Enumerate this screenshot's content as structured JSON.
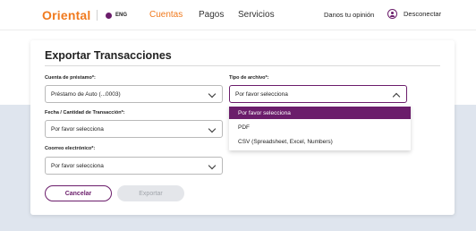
{
  "nav": {
    "logo": "Oriental",
    "lang": "ENG",
    "links": [
      "Cuentas",
      "Pagos",
      "Servicios"
    ],
    "feedback": "Danos tu opinión",
    "logout": "Desconectar"
  },
  "modal": {
    "title": "Exportar Transacciones",
    "loan_account_label": "Cuenta de préstamo*:",
    "loan_account_value": "Préstamo de Auto (...0003)",
    "file_type_label": "Tipo de archivo*:",
    "file_type_value": "Por favor selecciona",
    "date_label": "Fecha / Cantidad de Transacción*:",
    "date_value": "Por favor selecciona",
    "email_label": "Coorreo electrónico*:",
    "email_value": "Por favor selecciona",
    "file_type_options": [
      "Por favor selecciona",
      "PDF",
      "CSV (Spreadsheet, Excel, Numbers)"
    ],
    "cancel_label": "Cancelar",
    "export_label": "Exportar"
  },
  "colors": {
    "brand_orange": "#f07a1e",
    "brand_purple": "#6b1d6b",
    "page_band": "#dfe5ee"
  }
}
